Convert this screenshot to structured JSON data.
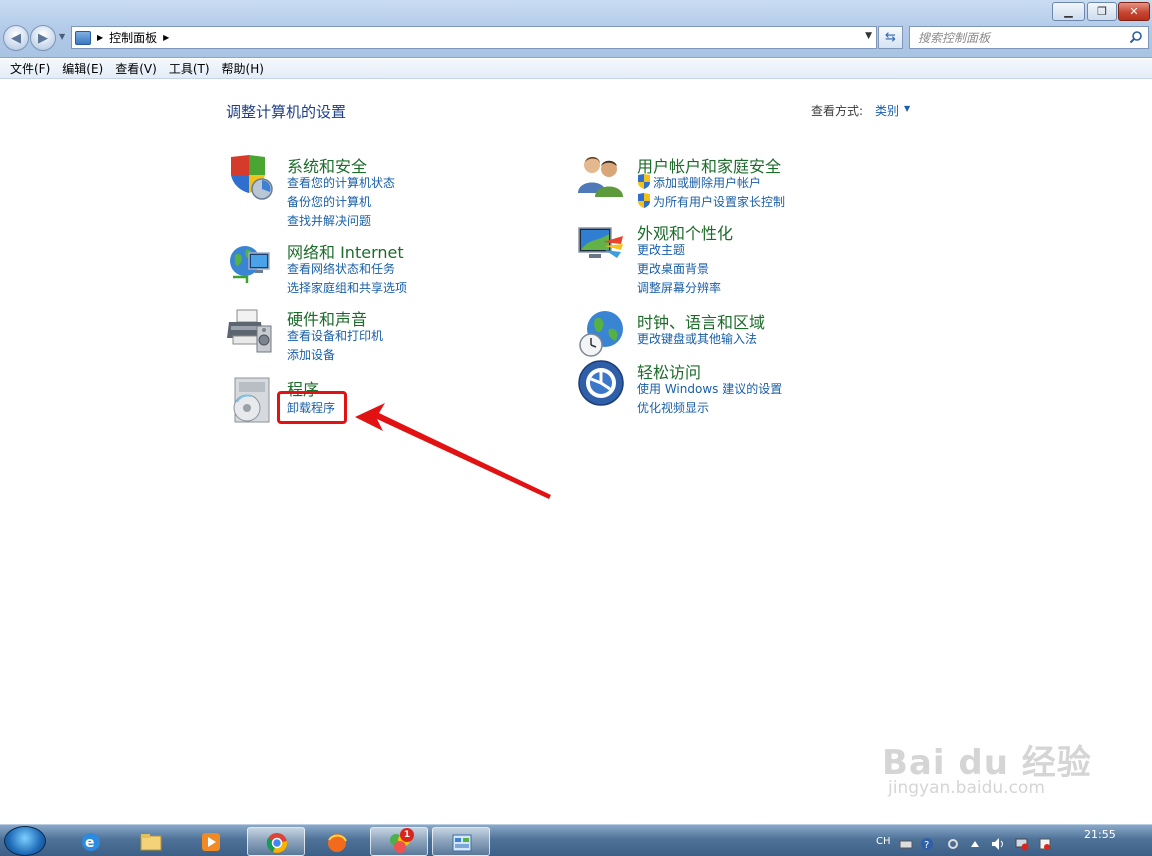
{
  "window": {
    "min": "▁",
    "max": "❐",
    "close": "✕"
  },
  "address": {
    "crumb": "控制面板"
  },
  "search": {
    "placeholder": "搜索控制面板"
  },
  "menu": [
    "文件(F)",
    "编辑(E)",
    "查看(V)",
    "工具(T)",
    "帮助(H)"
  ],
  "content": {
    "title": "调整计算机的设置",
    "view_by_label": "查看方式:",
    "view_by_value": "类别"
  },
  "categories": {
    "system": {
      "title": "系统和安全",
      "links": [
        "查看您的计算机状态",
        "备份您的计算机",
        "查找并解决问题"
      ]
    },
    "network": {
      "title": "网络和 Internet",
      "links": [
        "查看网络状态和任务",
        "选择家庭组和共享选项"
      ]
    },
    "hardware": {
      "title": "硬件和声音",
      "links": [
        "查看设备和打印机",
        "添加设备"
      ]
    },
    "programs": {
      "title": "程序",
      "links": [
        "卸载程序"
      ]
    },
    "users": {
      "title": "用户帐户和家庭安全",
      "links": [
        "添加或删除用户帐户",
        "为所有用户设置家长控制"
      ]
    },
    "appearance": {
      "title": "外观和个性化",
      "links": [
        "更改主题",
        "更改桌面背景",
        "调整屏幕分辨率"
      ]
    },
    "clock": {
      "title": "时钟、语言和区域",
      "links": [
        "更改键盘或其他输入法"
      ]
    },
    "ease": {
      "title": "轻松访问",
      "links": [
        "使用 Windows 建议的设置",
        "优化视频显示"
      ]
    }
  },
  "watermark": {
    "main": "Bai du 经验",
    "sub": "jingyan.baidu.com"
  },
  "taskbar": {
    "badge_count": "1",
    "lang": "CH",
    "clock": "21:55"
  },
  "colors": {
    "highlight": "#e31212",
    "link": "#1a5fa8",
    "category_title": "#1d6b2a"
  }
}
